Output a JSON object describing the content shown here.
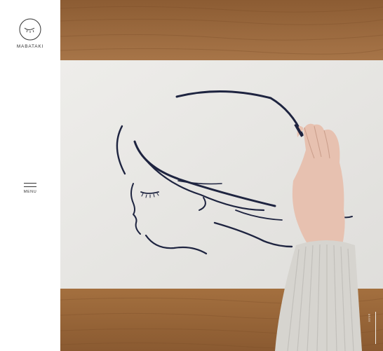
{
  "brand": {
    "logo_text": "MABATAKI"
  },
  "menu": {
    "label": "MENU"
  },
  "hero": {
    "description_alt": "Hand drawing a line illustration of a girl's profile on white paper over a wooden table"
  },
  "scroll": {
    "label": "scroll"
  },
  "colors": {
    "wood": "#9a6a3f",
    "paper": "#e9e8e5",
    "ink": "#1e2440",
    "sweater": "#d6d4cf",
    "skin": "#e7c1b0"
  }
}
